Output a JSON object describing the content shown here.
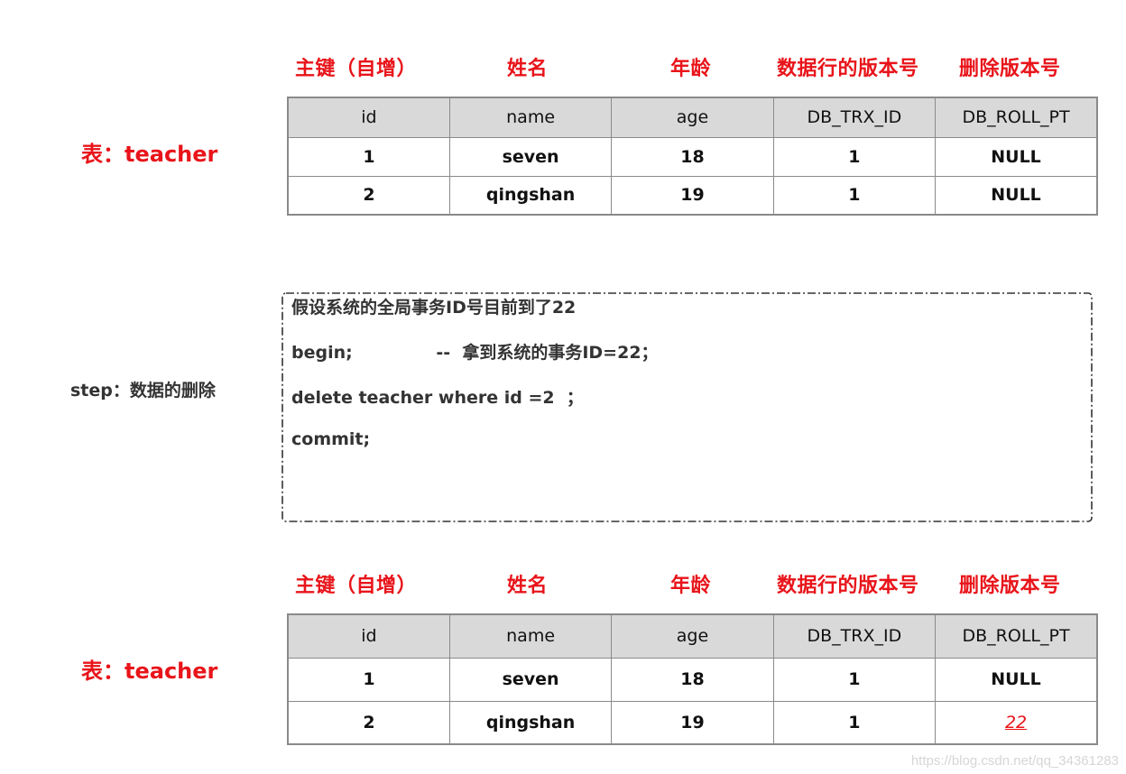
{
  "column_labels": [
    "主键（自增）",
    "姓名",
    "年龄",
    "数据行的版本号",
    "删除版本号"
  ],
  "table_before": {
    "label": "表：teacher",
    "headers": [
      "id",
      "name",
      "age",
      "DB_TRX_ID",
      "DB_ROLL_PT"
    ],
    "rows": [
      [
        "1",
        "seven",
        "18",
        "1",
        "NULL"
      ],
      [
        "2",
        "qingshan",
        "19",
        "1",
        "NULL"
      ]
    ]
  },
  "step": {
    "label": "step：数据的删除",
    "lines": [
      "假设系统的全局事务ID号目前到了22",
      "begin;              --  拿到系统的事务ID=22；",
      "delete teacher where id =2  ；",
      "commit;"
    ]
  },
  "table_after": {
    "label": "表：teacher",
    "headers": [
      "id",
      "name",
      "age",
      "DB_TRX_ID",
      "DB_ROLL_PT"
    ],
    "rows": [
      [
        "1",
        "seven",
        "18",
        "1",
        "NULL"
      ],
      [
        "2",
        "qingshan",
        "19",
        "1",
        "22"
      ]
    ],
    "highlight_cell": {
      "row": 1,
      "col": 4,
      "color": "#e8141a"
    }
  },
  "colors": {
    "accent_red": "#e8141a",
    "header_bg": "#d9d9d9",
    "border": "#8a8a8a",
    "text": "#111111"
  },
  "watermark": "https://blog.csdn.net/qq_34361283"
}
